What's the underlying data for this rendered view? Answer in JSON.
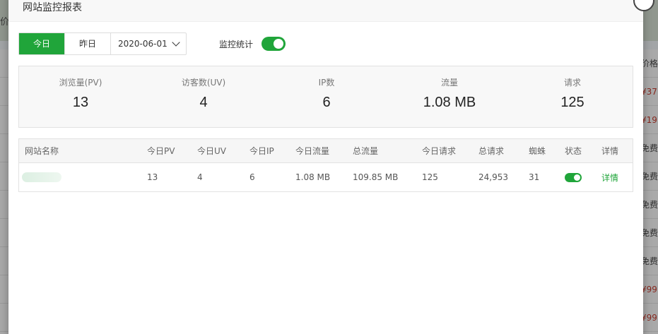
{
  "background": {
    "topbar_text": "价",
    "right_header": "价格",
    "right_cells": [
      "¥37",
      "¥19",
      "免费",
      "免费",
      "免费",
      "免费",
      "免费",
      "¥99",
      "¥99"
    ]
  },
  "modal": {
    "title": "网站监控报表"
  },
  "toolbar": {
    "tabs": [
      {
        "label": "今日",
        "active": true
      },
      {
        "label": "昨日",
        "active": false
      }
    ],
    "date_value": "2020-06-01",
    "monitor_label": "监控统计",
    "monitor_enabled": true
  },
  "stats": [
    {
      "label": "浏览量(PV)",
      "value": "13"
    },
    {
      "label": "访客数(UV)",
      "value": "4"
    },
    {
      "label": "IP数",
      "value": "6"
    },
    {
      "label": "流量",
      "value": "1.08 MB"
    },
    {
      "label": "请求",
      "value": "125"
    }
  ],
  "table": {
    "headers": [
      "网站名称",
      "今日PV",
      "今日UV",
      "今日IP",
      "今日流量",
      "总流量",
      "今日请求",
      "总请求",
      "蜘蛛",
      "状态",
      "详情"
    ],
    "rows": [
      {
        "pv": "13",
        "uv": "4",
        "ip": "6",
        "today_flow": "1.08 MB",
        "total_flow": "109.85 MB",
        "today_req": "125",
        "total_req": "24,953",
        "spider": "31",
        "status_enabled": true,
        "detail": "详情"
      }
    ]
  },
  "colors": {
    "accent": "#20a53a",
    "price_red": "#c0392b"
  }
}
